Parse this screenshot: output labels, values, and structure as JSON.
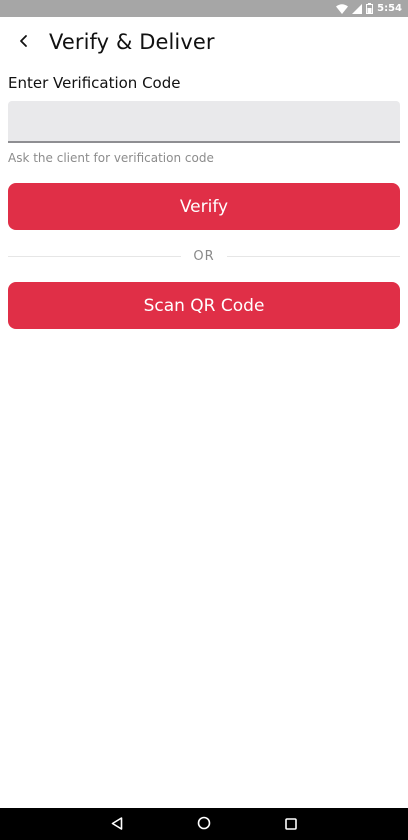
{
  "status_bar": {
    "time": "5:54",
    "icons": [
      "wifi-icon",
      "signal-icon",
      "battery-icon"
    ]
  },
  "toolbar": {
    "back_icon": "chevron-left-icon",
    "title": "Verify & Deliver"
  },
  "form": {
    "label": "Enter Verification Code",
    "input_value": "",
    "input_placeholder": "",
    "helper": "Ask the client for verification code"
  },
  "actions": {
    "verify_label": "Verify",
    "divider_label": "OR",
    "scan_label": "Scan QR Code"
  },
  "nav_bar": {
    "icons": [
      "back-triangle-icon",
      "home-circle-icon",
      "recents-square-icon"
    ]
  },
  "colors": {
    "accent": "#e02f47",
    "status_bar": "#a6a6a6",
    "input_bg": "#e9e9eb",
    "nav_bar": "#000000"
  }
}
